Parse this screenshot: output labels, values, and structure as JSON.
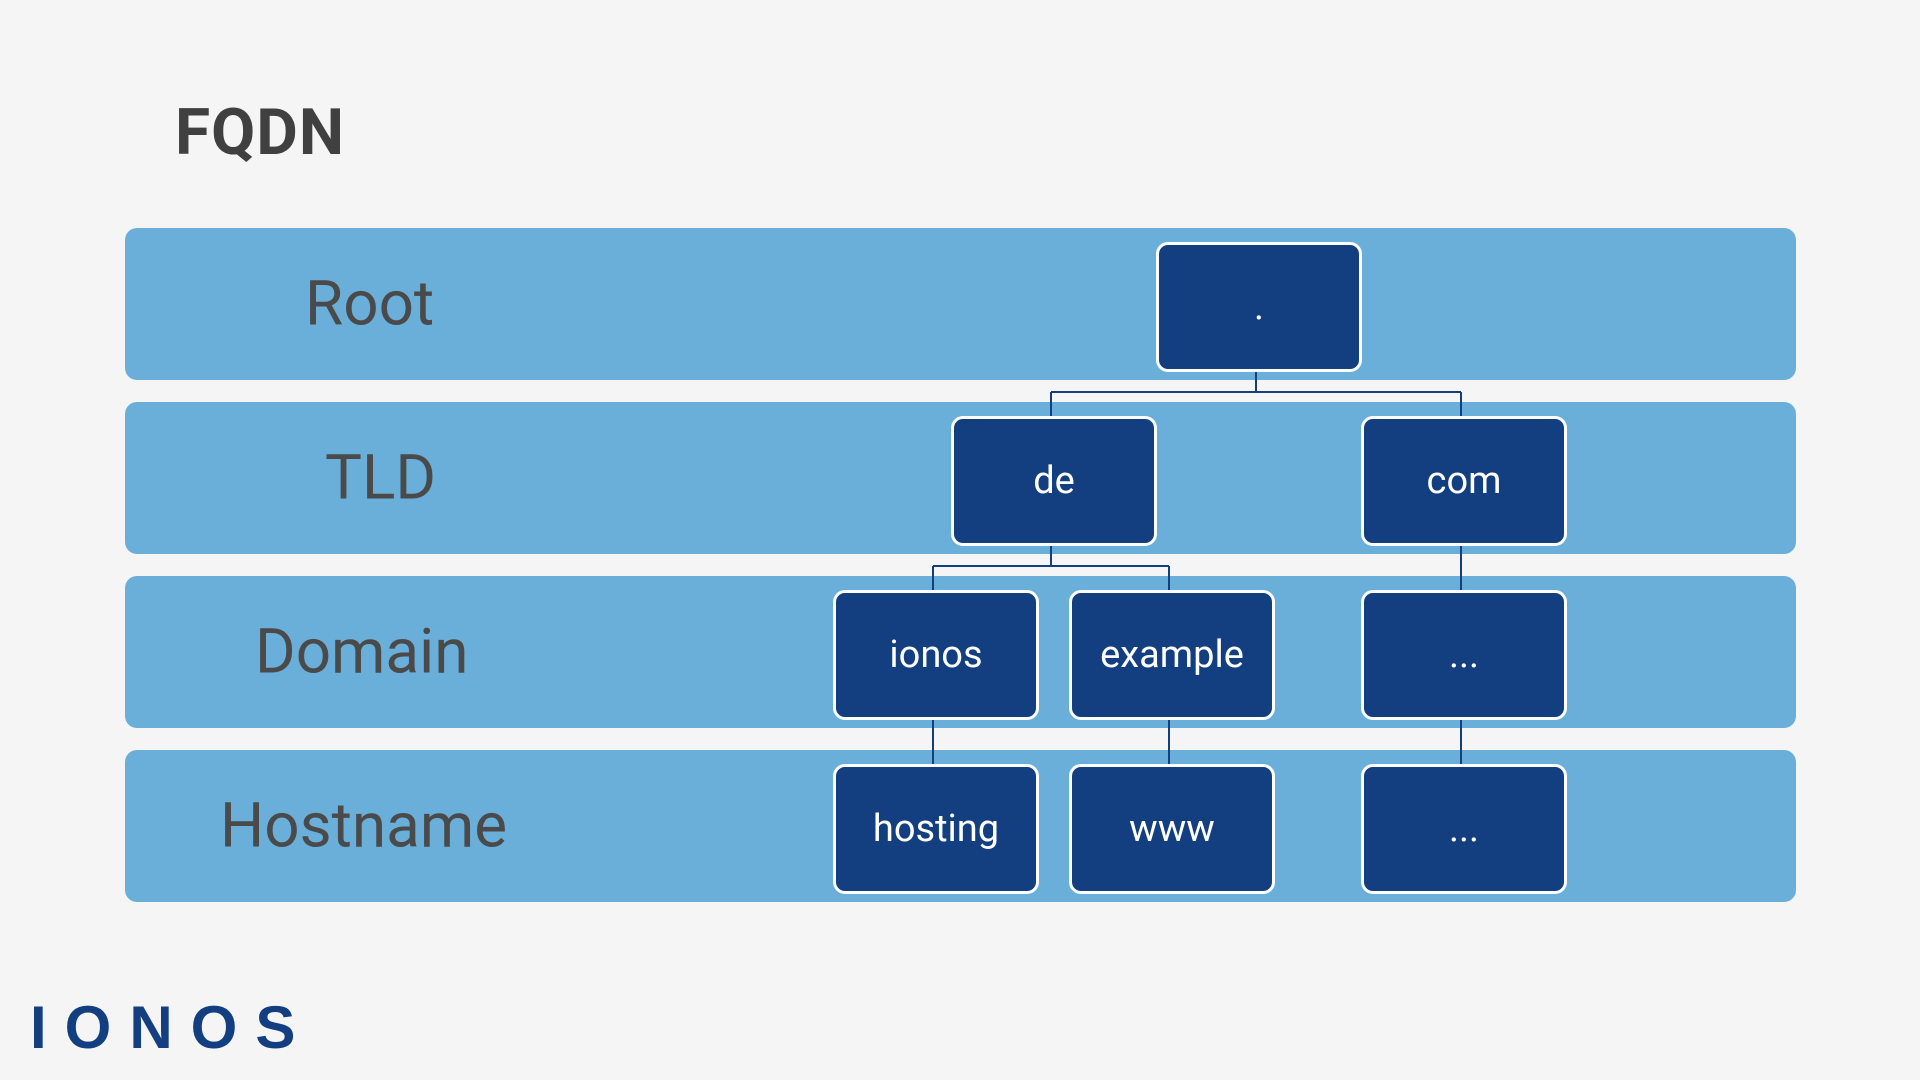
{
  "title": "FQDN",
  "rows": [
    {
      "label": "Root"
    },
    {
      "label": "TLD"
    },
    {
      "label": "Domain"
    },
    {
      "label": "Hostname"
    }
  ],
  "nodes": {
    "root": {
      "text": "."
    },
    "de": {
      "text": "de"
    },
    "com": {
      "text": "com"
    },
    "ionos": {
      "text": "ionos"
    },
    "example": {
      "text": "example"
    },
    "comdomain": {
      "text": "..."
    },
    "hosting": {
      "text": "hosting"
    },
    "www": {
      "text": "www"
    },
    "comhost": {
      "text": "..."
    }
  },
  "logo": "IONOS",
  "colors": {
    "band": "#6aafd9",
    "node": "#133f80",
    "text": "#404040"
  },
  "hierarchy": "root -> (de -> (ionos -> hosting, example -> www), com -> ... -> ...)"
}
